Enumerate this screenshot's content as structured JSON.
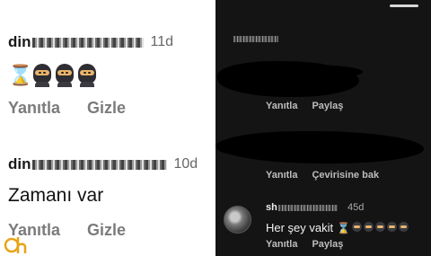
{
  "left": {
    "comments": [
      {
        "username_visible": "din",
        "time": "11d",
        "actions": [
          "Yanıtla",
          "Gizle"
        ]
      },
      {
        "username_visible": "din",
        "time": "10d",
        "text": "Zamanı var",
        "actions": [
          "Yanıtla",
          "Gizle"
        ]
      }
    ]
  },
  "right": {
    "comments": [
      {
        "actions": [
          "Yanıtla",
          "Paylaş"
        ]
      },
      {
        "actions": [
          "Yanıtla",
          "Çevirisine bak"
        ]
      },
      {
        "username_visible": "sh",
        "time": "45d",
        "text": "Her şey vakit",
        "actions": [
          "Yanıtla",
          "Paylaş"
        ]
      }
    ]
  },
  "icons": {
    "hourglass": "⌛",
    "ninja": "ninja-face-icon"
  },
  "colors": {
    "light_bg": "#ffffff",
    "dark_bg": "#141414",
    "action_gray_light": "#7b7b7b",
    "action_gray_dark": "#bdbdbd",
    "logo_accent": "#e6a417"
  }
}
